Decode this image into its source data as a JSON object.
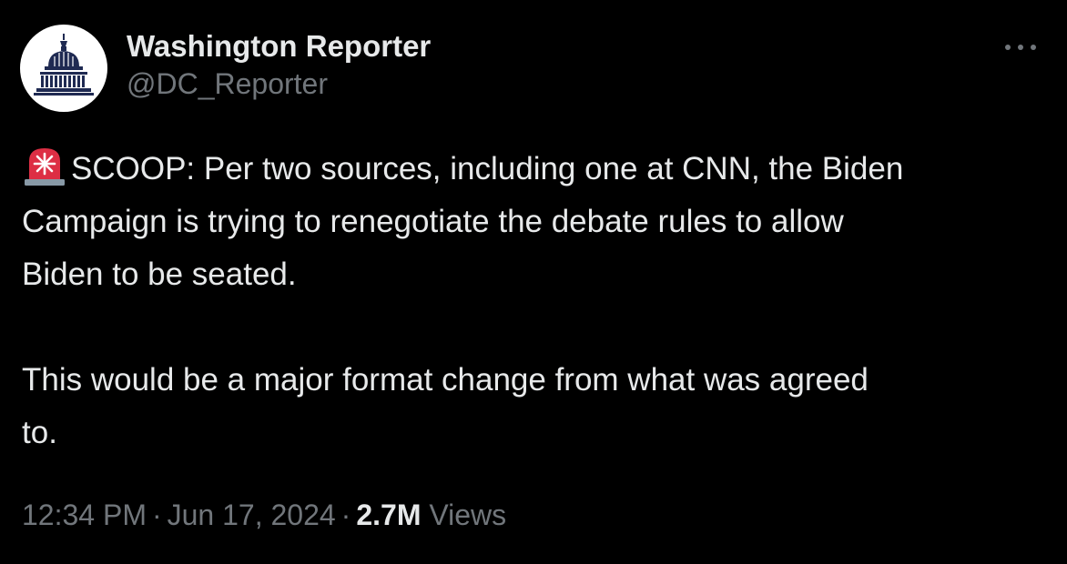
{
  "author": {
    "display_name": "Washington Reporter",
    "handle": "@DC_Reporter",
    "avatar_icon": "capitol-dome-icon"
  },
  "more_icon": "more-options-icon",
  "tweet": {
    "paragraph_1": {
      "icon": "police-siren-emoji",
      "line_1": "SCOOP: Per two sources, including one at CNN, the Biden",
      "line_2": "Campaign is trying to renegotiate the debate rules to allow",
      "line_3": "Biden to be seated."
    },
    "paragraph_2": {
      "line_1": "This would be a major format change from what was agreed",
      "line_2": "to."
    }
  },
  "meta": {
    "time": "12:34 PM",
    "separator": "·",
    "date": "Jun 17, 2024",
    "views_count": "2.7M",
    "views_label": "Views"
  },
  "colors": {
    "background": "#000000",
    "primary_text": "#e7e9ea",
    "secondary_text": "#71767b",
    "avatar_navy": "#1f2a52",
    "siren_red": "#dd2e44"
  }
}
